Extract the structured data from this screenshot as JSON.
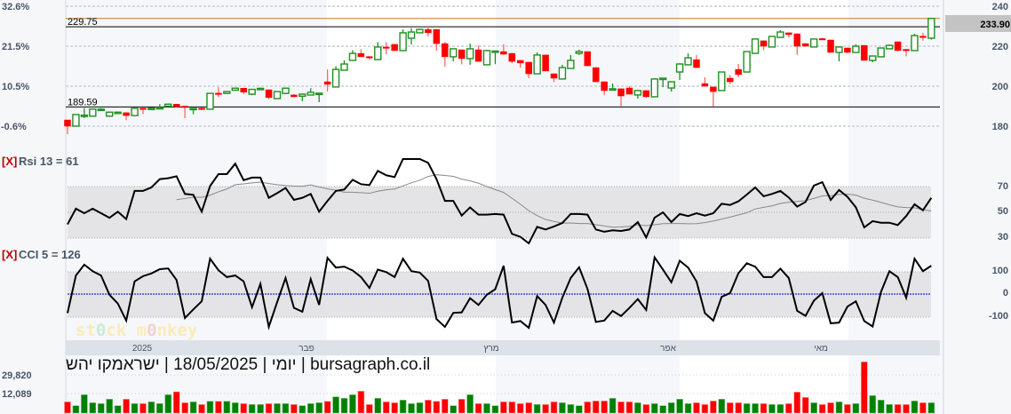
{
  "chart_data": {
    "type": "candlestick",
    "title": "יומי | 18/05/2025 | ישראמקו יהש | bursagraph.co.il",
    "last_price": "233.90",
    "price_axis": {
      "ticks": [
        "240",
        "220",
        "200",
        "180"
      ],
      "tick_values": [
        240,
        220,
        200,
        180
      ],
      "ylim": [
        180,
        240
      ]
    },
    "percent_axis": {
      "ticks": [
        "32.6%",
        "21.5%",
        "10.5%",
        "-0.6%"
      ]
    },
    "levels": [
      {
        "label": "229.75",
        "value": 229.75
      },
      {
        "label": "189.59",
        "value": 189.59
      }
    ],
    "x_labels": [
      "2025",
      "פבר",
      "מרץ",
      "אפר",
      "מאי"
    ],
    "ohlc_format": "open, high, low, close",
    "candles": [
      [
        183.1,
        183.1,
        176,
        180
      ],
      [
        180,
        186,
        180,
        185.8
      ],
      [
        185,
        189,
        184,
        185.5
      ],
      [
        185,
        188.8,
        185,
        188.5
      ],
      [
        188,
        189,
        187.8,
        188.5
      ],
      [
        185,
        187.3,
        184.8,
        187
      ],
      [
        186.5,
        187.3,
        186.3,
        187
      ],
      [
        186.7,
        187,
        183,
        185.3
      ],
      [
        185.3,
        189.2,
        185,
        188.9
      ],
      [
        189,
        189.2,
        186,
        188.5
      ],
      [
        188.4,
        189.2,
        188.2,
        189
      ],
      [
        189,
        191,
        188.8,
        189.3
      ],
      [
        190,
        191.3,
        189.8,
        191
      ],
      [
        191,
        191.2,
        189.6,
        189.8
      ],
      [
        190,
        190.2,
        184,
        189.5
      ],
      [
        188.5,
        189.1,
        186,
        188.9
      ],
      [
        189,
        189.2,
        188,
        188.5
      ],
      [
        188.5,
        196.6,
        188.3,
        196.4
      ],
      [
        196.5,
        199.5,
        194.5,
        196.3
      ],
      [
        196.4,
        197.6,
        196,
        197.3
      ],
      [
        198,
        199.2,
        197.8,
        199
      ],
      [
        199,
        199.2,
        196,
        197
      ],
      [
        196,
        198.6,
        195.5,
        198.4
      ],
      [
        198.7,
        199.3,
        198.3,
        198.9
      ],
      [
        198.2,
        198.4,
        193.5,
        194.3
      ],
      [
        193.8,
        197.5,
        193.5,
        197.3
      ],
      [
        196.4,
        199.2,
        196,
        199
      ],
      [
        195.6,
        196,
        194.5,
        194.7
      ],
      [
        195,
        196.3,
        192.5,
        196
      ],
      [
        195.6,
        199,
        195.4,
        196.9
      ],
      [
        196,
        196.7,
        192,
        196.5
      ],
      [
        202.2,
        208.4,
        197.3,
        200.9
      ],
      [
        199.6,
        210,
        199.4,
        208.4
      ],
      [
        208,
        213,
        207.8,
        211.1
      ],
      [
        212.9,
        218,
        212.7,
        216.4
      ],
      [
        216.4,
        218.5,
        214.5,
        214.7
      ],
      [
        214.8,
        215.2,
        213.3,
        214.5
      ],
      [
        213.3,
        222,
        213.1,
        219.6
      ],
      [
        219.6,
        222,
        216,
        219.3
      ],
      [
        220.9,
        221.1,
        217.6,
        217.8
      ],
      [
        217.8,
        228.4,
        217.6,
        226.7
      ],
      [
        224,
        229,
        220.9,
        227.1
      ],
      [
        226.7,
        228.8,
        226.5,
        228.4
      ],
      [
        228.4,
        229.8,
        224.9,
        226.7
      ],
      [
        228.4,
        228.6,
        217.8,
        221.3
      ],
      [
        221.3,
        222,
        209.8,
        214.7
      ],
      [
        214.7,
        218.9,
        212.4,
        218.7
      ],
      [
        218.2,
        218.4,
        210.9,
        213.8
      ],
      [
        213.8,
        221.3,
        210.7,
        218.7
      ],
      [
        218.2,
        220.4,
        212.2,
        212.4
      ],
      [
        210.7,
        218.2,
        210.5,
        217.8
      ],
      [
        217.3,
        217.8,
        211,
        217.6
      ],
      [
        217.3,
        221,
        215.6,
        216
      ],
      [
        216.4,
        216.6,
        211.5,
        212.4
      ],
      [
        212.9,
        213.1,
        209.3,
        211.6
      ],
      [
        212,
        212.2,
        204,
        206.2
      ],
      [
        206.2,
        216.9,
        206,
        215.6
      ],
      [
        215.6,
        215.8,
        207.4,
        207.6
      ],
      [
        206.2,
        206.4,
        202,
        204
      ],
      [
        203.6,
        210.7,
        203.4,
        209.3
      ],
      [
        208.9,
        215.6,
        208.7,
        212.9
      ],
      [
        216.4,
        218.2,
        215.6,
        217.3
      ],
      [
        217.3,
        217.5,
        210,
        210.2
      ],
      [
        209.3,
        209.5,
        202,
        202.2
      ],
      [
        202.2,
        202.4,
        195.6,
        197.8
      ],
      [
        198.2,
        201.3,
        197.8,
        198.7
      ],
      [
        198.7,
        198.9,
        189.8,
        195.1
      ],
      [
        199.1,
        200,
        195.8,
        196
      ],
      [
        195.6,
        198.2,
        193.8,
        197.8
      ],
      [
        197.8,
        198,
        194.2,
        194.7
      ],
      [
        194.7,
        204,
        194.5,
        203.6
      ],
      [
        203.6,
        204.2,
        199.5,
        204
      ],
      [
        199.1,
        202.5,
        197.3,
        202.2
      ],
      [
        207.1,
        211.5,
        203.1,
        211.1
      ],
      [
        210.7,
        216.4,
        210.5,
        214.2
      ],
      [
        213.3,
        215.6,
        209.1,
        209.3
      ],
      [
        201.3,
        204.5,
        199.8,
        200
      ],
      [
        199.6,
        199.8,
        189.8,
        197.3
      ],
      [
        197.8,
        207.3,
        197.6,
        207.1
      ],
      [
        204,
        205.5,
        201,
        202.2
      ],
      [
        208.4,
        211.1,
        204.4,
        205.8
      ],
      [
        207.1,
        217.5,
        206.9,
        217.3
      ],
      [
        216.4,
        223.8,
        216.2,
        223.6
      ],
      [
        222.7,
        222.9,
        218,
        220
      ],
      [
        219.6,
        225.1,
        219.4,
        224.9
      ],
      [
        224.4,
        228,
        224.2,
        227.1
      ],
      [
        226.7,
        226.9,
        224.4,
        225.8
      ],
      [
        226.2,
        226.4,
        215.6,
        220
      ],
      [
        221.3,
        221.5,
        219.8,
        220
      ],
      [
        219.6,
        223.8,
        219.4,
        223.6
      ],
      [
        223.8,
        224.2,
        223.2,
        223.5
      ],
      [
        223.1,
        223.3,
        216.7,
        216.9
      ],
      [
        216.9,
        219.8,
        212.4,
        219.6
      ],
      [
        219.1,
        219.3,
        216.5,
        216.9
      ],
      [
        216.9,
        220.9,
        216.7,
        220
      ],
      [
        220.4,
        220.6,
        212.7,
        212.9
      ],
      [
        212.9,
        215.3,
        212,
        215.1
      ],
      [
        214.7,
        219.3,
        214.5,
        219.1
      ],
      [
        218.7,
        220.9,
        218.5,
        220.4
      ],
      [
        222.2,
        222.4,
        217.6,
        217.8
      ],
      [
        218.4,
        218.6,
        215,
        218.2
      ],
      [
        217.8,
        226.2,
        217.6,
        225.3
      ],
      [
        225,
        226.7,
        222.7,
        224.9
      ],
      [
        224,
        234,
        223.3,
        233.9
      ]
    ],
    "rsi": {
      "close_label": "[X]",
      "label": "Rsi 13 = 61",
      "ticks": [
        "70",
        "50",
        "30"
      ],
      "tick_values": [
        70,
        50,
        30
      ],
      "signal_period": 13,
      "values": [
        40.9,
        53,
        49.5,
        53,
        49.5,
        46,
        50.7,
        45,
        66.7,
        66.7,
        69.4,
        75.8,
        76.5,
        78,
        64.4,
        63.7,
        50.7,
        70.5,
        79.7,
        79.7,
        87.7,
        75,
        77,
        77,
        61.4,
        65,
        69,
        59.8,
        61.4,
        64.4,
        50.7,
        59,
        66.7,
        67.8,
        75.3,
        71.9,
        71.2,
        82.2,
        78.8,
        77.4,
        91.3,
        91.3,
        91.3,
        88.4,
        75.8,
        59,
        59,
        47.7,
        54,
        48.4,
        48.4,
        48.9,
        48.4,
        33.6,
        31.3,
        26.3,
        39,
        37,
        39.3,
        42,
        48.9,
        48.9,
        48.4,
        37,
        35.2,
        36.3,
        35.8,
        37,
        42.7,
        30.8,
        46.1,
        50.2,
        42.7,
        48.9,
        47.3,
        49.5,
        47.7,
        49.5,
        56.8,
        55.9,
        58.7,
        63.9,
        69.4,
        62.6,
        64.4,
        66.7,
        61.6,
        54.6,
        58.2,
        70.8,
        73.5,
        59.8,
        67.4,
        62.1,
        54.1,
        38.6,
        43.4,
        42.2,
        42.2,
        40.4,
        47.3,
        56.4,
        51.8,
        61.4
      ]
    },
    "cci": {
      "close_label": "[X]",
      "label": "CCI 5 = 126",
      "ticks": [
        "100",
        "0",
        "-100"
      ],
      "tick_values": [
        100,
        0,
        -100
      ],
      "values": [
        -84,
        82,
        130,
        101,
        82,
        -3,
        -42,
        -117,
        56,
        79,
        91,
        110,
        113,
        62,
        -106,
        -68,
        -32,
        156,
        105,
        75,
        82,
        56,
        -58,
        45,
        -145,
        -35,
        71,
        -61,
        -78,
        66,
        -48,
        160,
        117,
        121,
        104,
        75,
        27,
        108,
        97,
        75,
        156,
        101,
        95,
        58,
        -110,
        -145,
        -83,
        -81,
        -18,
        -48,
        -3,
        21,
        125,
        -126,
        -119,
        -149,
        -9,
        -48,
        -126,
        -16,
        71,
        118,
        23,
        -123,
        -117,
        -74,
        -97,
        -61,
        -22,
        -70,
        162,
        108,
        52,
        147,
        117,
        56,
        -84,
        -117,
        -12,
        4,
        92,
        136,
        121,
        75,
        75,
        112,
        71,
        -74,
        -96,
        -29,
        4,
        -129,
        -126,
        -55,
        -32,
        -119,
        -143,
        10,
        101,
        75,
        -16,
        156,
        101,
        125
      ]
    },
    "volume": {
      "ticks": [
        "29,820",
        "12,089"
      ],
      "tick_values": [
        29820,
        12089
      ],
      "values": [
        4488,
        829,
        11245,
        3644,
        2800,
        7022,
        829,
        7022,
        2800,
        2800,
        4488,
        2800,
        11245,
        14060,
        3644,
        4488,
        1955,
        5051,
        5051,
        5051,
        3644,
        2800,
        1955,
        1955,
        2800,
        2800,
        2800,
        1955,
        829,
        2800,
        3644,
        5051,
        9274,
        7867,
        11245,
        14623,
        1955,
        7867,
        4488,
        3644,
        6178,
        2800,
        3644,
        6178,
        5051,
        7022,
        829,
        7022,
        11245,
        2800,
        2800,
        829,
        4488,
        4488,
        2800,
        3644,
        1955,
        1955,
        4488,
        3644,
        1955,
        829,
        4488,
        5333,
        5333,
        7867,
        4488,
        4488,
        3644,
        1955,
        2800,
        829,
        3644,
        7022,
        2800,
        3644,
        1955,
        5333,
        7022,
        3644,
        3644,
        2800,
        2800,
        2800,
        1955,
        1955,
        2800,
        13778,
        8711,
        3644,
        1955,
        3644,
        4488,
        1955,
        2800,
        42491,
        10400,
        6178,
        1955,
        1955,
        1955,
        5333,
        3644,
        3644
      ]
    },
    "colors": {
      "up": "#1f8f1f",
      "down": "#ff0000",
      "vol_up": "#008000",
      "vol_down": "#ff0000",
      "last_line": "#c87a2a",
      "cci_zero": "#2020e0",
      "signal": "#888888"
    }
  },
  "logo": "st0ck m0nkey"
}
